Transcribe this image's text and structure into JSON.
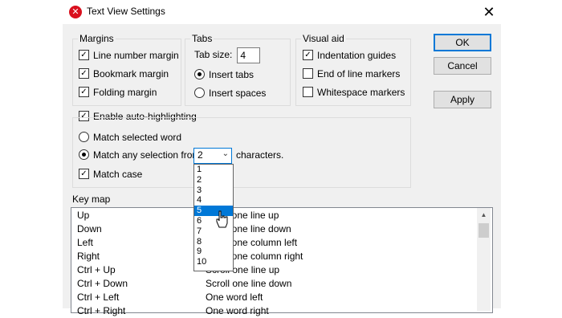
{
  "window": {
    "title": "Text View Settings"
  },
  "margins": {
    "title": "Margins",
    "items": [
      {
        "label": "Line number margin",
        "checked": true
      },
      {
        "label": "Bookmark margin",
        "checked": true
      },
      {
        "label": "Folding margin",
        "checked": true
      }
    ]
  },
  "tabs": {
    "title": "Tabs",
    "size_label": "Tab size:",
    "size_value": "4",
    "insert_tabs": "Insert tabs",
    "insert_spaces": "Insert spaces"
  },
  "visual_aid": {
    "title": "Visual aid",
    "items": [
      {
        "label": "Indentation guides",
        "checked": true
      },
      {
        "label": "End of line markers",
        "checked": false
      },
      {
        "label": "Whitespace markers",
        "checked": false
      }
    ]
  },
  "buttons": {
    "ok": "OK",
    "cancel": "Cancel",
    "apply": "Apply"
  },
  "highlight": {
    "enable_label": "Enable auto-highlighting",
    "match_selected": "Match selected word",
    "match_any": "Match any selection from:",
    "characters_suffix": "characters.",
    "match_case": "Match case",
    "selected_value": "2",
    "options": [
      "1",
      "2",
      "3",
      "4",
      "5",
      "6",
      "7",
      "8",
      "9",
      "10"
    ],
    "hovered_option": "5"
  },
  "keymap": {
    "title": "Key map",
    "rows": [
      {
        "key": "Up",
        "action": "Move one line up"
      },
      {
        "key": "Down",
        "action": "Move one line down"
      },
      {
        "key": "Left",
        "action": "Move one column left"
      },
      {
        "key": "Right",
        "action": "Move one column right"
      },
      {
        "key": "Ctrl + Up",
        "action": "Scroll one line up"
      },
      {
        "key": "Ctrl + Down",
        "action": "Scroll one line down"
      },
      {
        "key": "Ctrl + Left",
        "action": "One word left"
      },
      {
        "key": "Ctrl + Right",
        "action": "One word right"
      }
    ]
  }
}
